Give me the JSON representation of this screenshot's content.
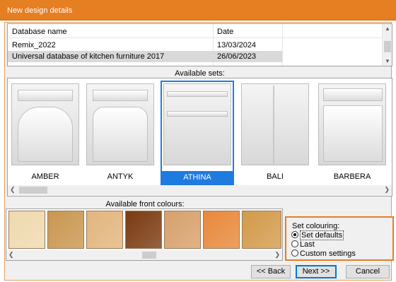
{
  "window": {
    "title": "New design details"
  },
  "database_table": {
    "columns": [
      "Database name",
      "Date"
    ],
    "rows": [
      {
        "name": "Remix_2022",
        "date": "13/03/2024",
        "selected": false
      },
      {
        "name": "Universal database of kitchen furniture 2017",
        "date": "26/06/2023",
        "selected": true
      }
    ]
  },
  "sets": {
    "label": "Available sets:",
    "items": [
      "AMBER",
      "ANTYK",
      "ATHINA",
      "BALI",
      "BARBERA"
    ],
    "selected": "ATHINA"
  },
  "front_colours": {
    "label": "Available front colours:",
    "swatches": [
      "#efd9ae",
      "#c9964f",
      "#e2b57c",
      "#7a3a10",
      "#d7a06a",
      "#e8883a",
      "#d39a4a"
    ]
  },
  "colouring": {
    "title": "Set colouring:",
    "options": [
      "Set defaults",
      "Last",
      "Custom settings"
    ],
    "selected": "Set defaults"
  },
  "buttons": {
    "back": "<< Back",
    "next": "Next >>",
    "cancel": "Cancel"
  },
  "colors": {
    "accent": "#e67e22",
    "selection": "#1f7be0"
  }
}
